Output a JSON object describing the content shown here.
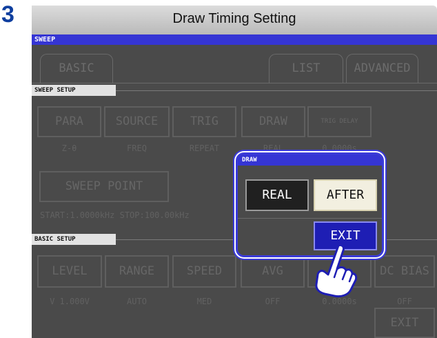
{
  "step_number": "3",
  "header": {
    "title": "Draw Timing Setting"
  },
  "screen": {
    "mode_label": "SWEEP",
    "tabs": [
      "BASIC",
      "LIST",
      "ADVANCED"
    ],
    "sweep_setup": {
      "label": "SWEEP SETUP",
      "buttons": [
        {
          "label": "PARA",
          "value": "Z-θ"
        },
        {
          "label": "SOURCE",
          "value": "FREQ"
        },
        {
          "label": "TRIG",
          "value": "REPEAT"
        },
        {
          "label": "DRAW",
          "value": "REAL"
        },
        {
          "label": "TRIG DELAY",
          "value": "0.0000s"
        }
      ],
      "sweep_point_label": "SWEEP POINT",
      "range_text": "START:1.0000kHz STOP:100.00kHz"
    },
    "basic_setup": {
      "label": "BASIC SETUP",
      "buttons": [
        {
          "label": "LEVEL",
          "value": "V 1.000V"
        },
        {
          "label": "RANGE",
          "value": "AUTO"
        },
        {
          "label": "SPEED",
          "value": "MED"
        },
        {
          "label": "AVG",
          "value": "OFF"
        },
        {
          "label": "DELAY",
          "value": "0.0000s"
        },
        {
          "label": "DC BIAS",
          "value": "OFF"
        }
      ]
    },
    "exit_label": "EXIT"
  },
  "dialog": {
    "title": "DRAW",
    "options": [
      "REAL",
      "AFTER"
    ],
    "selected": "AFTER",
    "exit_label": "EXIT"
  },
  "colors": {
    "accent_blue": "#3535d4",
    "step_number": "#0f3f9f",
    "exit_button": "#1e1eb4"
  }
}
